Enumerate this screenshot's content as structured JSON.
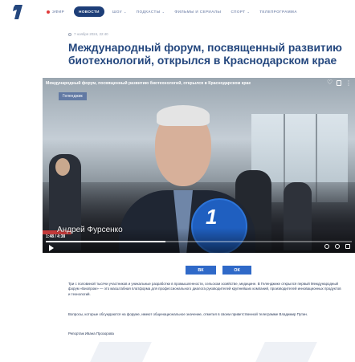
{
  "nav": {
    "items": [
      {
        "label": "ЭФИР",
        "live": true,
        "active": false,
        "caret": false
      },
      {
        "label": "НОВОСТИ",
        "live": false,
        "active": true,
        "caret": false
      },
      {
        "label": "ШОУ",
        "live": false,
        "active": false,
        "caret": true
      },
      {
        "label": "ПОДКАСТЫ",
        "live": false,
        "active": false,
        "caret": true
      },
      {
        "label": "ФИЛЬМЫ И СЕРИАЛЫ",
        "live": false,
        "active": false,
        "caret": false
      },
      {
        "label": "СПОРТ",
        "live": false,
        "active": false,
        "caret": true
      },
      {
        "label": "ТЕЛЕПРОГРАММА",
        "live": false,
        "active": false,
        "caret": false
      }
    ]
  },
  "article": {
    "date": "7 ноября 2024, 22:40",
    "title": "Международный форум, посвященный развитию биотехнологий, открылся в Краснодарском крае",
    "paragraphs": [
      "Три с половиной тысячи участников и уникальные разработки в промышленности, сельском хозяйстве, медицине. В Геленджике открылся первый Международный форум «Биопром» — это масштабная платформа для профессионального диалога руководителей крупнейших компаний, производителей инновационных продуктов и технологий.",
      "Вопросы, которые обсуждаются на форуме, имеют общенациональное значение, отметил в своем приветственной телеграмме Владимир Путин.",
      "Репортаж Ивана Прозорова"
    ]
  },
  "video": {
    "title": "Международный форум, посвященный развитию биотехнологий, открылся в Краснодарском крае",
    "geo_tag": "Геленджик",
    "lower_third": "Андрей Фурсенко",
    "time": "1:48 / 4:38",
    "progress_fraction": 0.39,
    "mic_logo": "1"
  },
  "share": {
    "vk": "ВК",
    "ok": "ОК"
  },
  "colors": {
    "brand_blue": "#24477e",
    "nav_active": "#1d3e78",
    "share_blue": "#2f69c8",
    "live_red": "#e03a3a"
  }
}
